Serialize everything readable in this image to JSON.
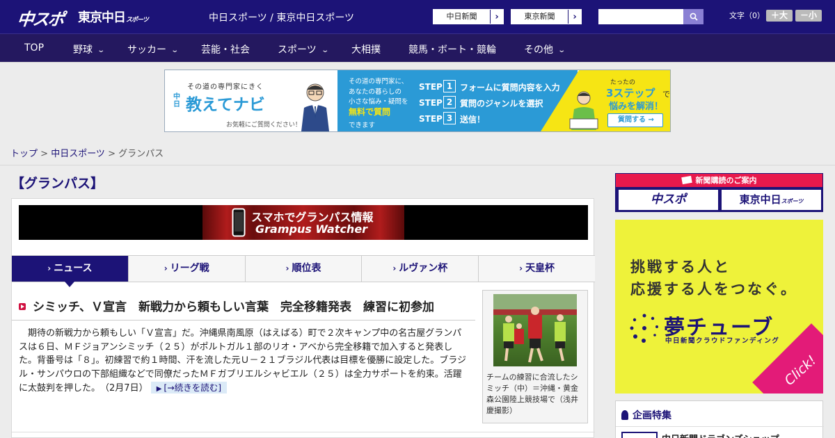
{
  "header": {
    "logo_chuspo": "中スポ",
    "logo_tokyo": "東京中日",
    "logo_tokyo_sub": "スポーツ",
    "site_title": "中日スポーツ / 東京中日スポーツ",
    "link_chunichi": "中日新聞",
    "link_tokyo": "東京新聞",
    "search_placeholder": "",
    "fontsize_label": "文字（0）",
    "font_plus": "＋大",
    "font_minus": "－小"
  },
  "nav": {
    "items": [
      {
        "label": "TOP"
      },
      {
        "label": "野球"
      },
      {
        "label": "サッカー"
      },
      {
        "label": "芸能・社会"
      },
      {
        "label": "スポーツ"
      },
      {
        "label": "大相撲"
      },
      {
        "label": "競馬・ボート・競輪"
      },
      {
        "label": "その他"
      }
    ]
  },
  "ad_banner": {
    "tagline": "その道の専門家にきく",
    "brand_prefix": "中日",
    "brand": "教えてナビ",
    "note": "お気軽にご質問ください！",
    "mid_text1": "その道の専門家に、",
    "mid_text2": "あなたの暮らしの",
    "mid_text3": "小さな悩み・疑問を",
    "mid_highlight": "無料で質問",
    "mid_text4": "できます",
    "step_word": "STEP",
    "step1_num": "1",
    "step1": "フォームに質問内容を入力",
    "step2_num": "2",
    "step2": "質問のジャンルを選択",
    "step3_num": "3",
    "step3": "送信！",
    "right_small": "たったの",
    "right_big": "3ステップ",
    "right_de": "で",
    "right_sub": "悩みを解消！",
    "right_btn": "質問する"
  },
  "breadcrumb": {
    "home": "トップ",
    "sep1": " > ",
    "section": "中日スポーツ",
    "sep2": " > ",
    "current": "グランパス"
  },
  "page_heading": "【グランパス】",
  "grampus_banner": {
    "line1": "スマホでグランパス情報",
    "line2": "Grampus Watcher"
  },
  "tabs": [
    {
      "label": "ニュース"
    },
    {
      "label": "リーグ戦"
    },
    {
      "label": "順位表"
    },
    {
      "label": "ルヴァン杯"
    },
    {
      "label": "天皇杯"
    }
  ],
  "article": {
    "title": "シミッチ、Ｖ宣言　新戦力から頼もしい言葉　完全移籍発表　練習に初参加",
    "body": "期待の新戦力から頼もしい「Ｖ宣言」だ。沖縄県南風原（はえばる）町で２次キャンプ中の名古屋グランパスは６日、ＭＦジョアンシミッチ（２５）がポルトガル１部のリオ・アベから完全移籍で加入すると発表した。背番号は「８」。初練習で約１時間、汗を流した元Ｕ－２１ブラジル代表は目標を優勝に設定した。ブラジル・サンパウロの下部組織などで同僚だったＭＦガブリエルシャビエル（２５）は全力サポートを約束。活躍に太鼓判を押した。",
    "date": "（2月7日）",
    "read_more": "[→続きを読む]",
    "photo_caption": "チームの練習に合流したシミッチ（中）＝沖縄・黄金森公園陸上競技場で（浅井慶撮影）"
  },
  "sidebar": {
    "subscribe_head": "新聞購読のご案内",
    "sub_btn1": "中スポ",
    "sub_btn2": "東京中日",
    "sub_btn2_small": "スポーツ",
    "ad_line1": "挑戦する人と",
    "ad_line2": "応援する人をつなぐ。",
    "ad_brand": "夢チューブ",
    "ad_brand_sub": "中日新聞クラウドファンディング",
    "ad_click": "Click!",
    "feature_head": "企画特集",
    "feature_item": "中日新聞ドラゴンズショップ"
  },
  "colors": {
    "brand_navy": "#1c1377",
    "nav_dark": "#24185f",
    "accent_red": "#e8194c",
    "ad_yellow": "#eef23a",
    "ad_pink": "#e31b78"
  }
}
